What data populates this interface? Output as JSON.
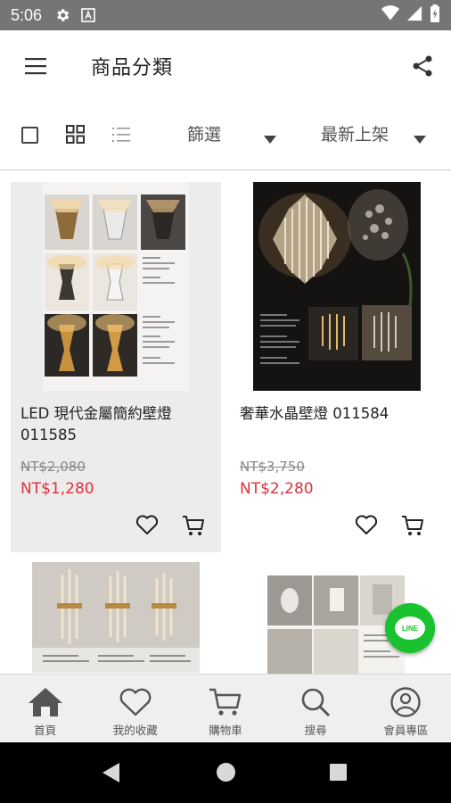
{
  "status": {
    "time": "5:06"
  },
  "header": {
    "title": "商品分類"
  },
  "toolbar": {
    "filter_label": "篩選",
    "sort_label": "最新上架"
  },
  "products": [
    {
      "name": "LED 現代金屬簡約壁燈 011585",
      "old_price": "NT$2,080",
      "price": "NT$1,280"
    },
    {
      "name": "奢華水晶壁燈 011584",
      "old_price": "NT$3,750",
      "price": "NT$2,280"
    }
  ],
  "nav": {
    "items": [
      {
        "label": "首頁",
        "icon": "home-icon"
      },
      {
        "label": "我的收藏",
        "icon": "heart-icon"
      },
      {
        "label": "購物車",
        "icon": "cart-icon"
      },
      {
        "label": "搜尋",
        "icon": "search-icon"
      },
      {
        "label": "會員專區",
        "icon": "user-icon"
      }
    ]
  },
  "line_button": {
    "label": "LINE"
  },
  "colors": {
    "sale_price": "#e0303b",
    "line_green": "#19c22e",
    "status_bar": "#757575"
  }
}
